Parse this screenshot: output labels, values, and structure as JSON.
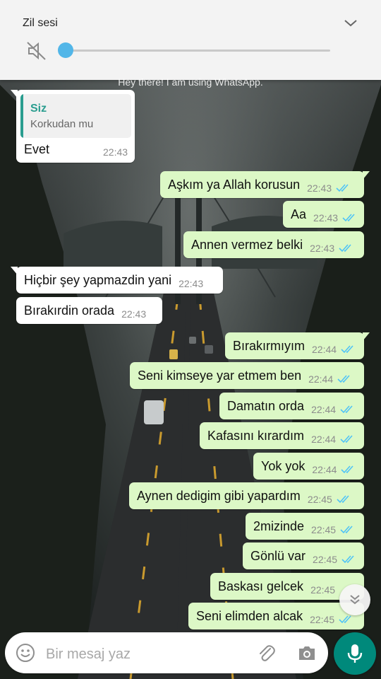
{
  "volume_panel": {
    "title": "Zil sesi",
    "level": 0
  },
  "chat": {
    "status_hint": "Hey there! I am using WhatsApp.",
    "reply": {
      "quote_author": "Siz",
      "quote_text": "Korkudan mu",
      "text": "Evet",
      "time": "22:43"
    },
    "messages": [
      {
        "dir": "out",
        "text": "Aşkım ya Allah korusun",
        "time": "22:43"
      },
      {
        "dir": "out",
        "text": "Aa",
        "time": "22:43"
      },
      {
        "dir": "out",
        "text": "Annen vermez belki",
        "time": "22:43"
      },
      {
        "dir": "in",
        "text": "Hiçbir şey yapmazdin yani",
        "time": "22:43"
      },
      {
        "dir": "in",
        "text": "Bırakırdin orada",
        "time": "22:43"
      },
      {
        "dir": "out",
        "text": "Bırakırmıyım",
        "time": "22:44"
      },
      {
        "dir": "out",
        "text": "Seni kimseye yar etmem ben",
        "time": "22:44"
      },
      {
        "dir": "out",
        "text": "Damatın orda",
        "time": "22:44"
      },
      {
        "dir": "out",
        "text": "Kafasını kırardım",
        "time": "22:44"
      },
      {
        "dir": "out",
        "text": "Yok yok",
        "time": "22:44"
      },
      {
        "dir": "out",
        "text": "Aynen dedigim gibi yapardım",
        "time": "22:45"
      },
      {
        "dir": "out",
        "text": "2mizinde",
        "time": "22:45"
      },
      {
        "dir": "out",
        "text": "Gönlü var",
        "time": "22:45"
      },
      {
        "dir": "out",
        "text": "Baskası gelcek",
        "time": "22:45"
      },
      {
        "dir": "out",
        "text": "Seni elimden alcak",
        "time": "22:45"
      }
    ]
  },
  "composer": {
    "placeholder": "Bir mesaj yaz"
  },
  "colors": {
    "outgoing": "#dcf8c6",
    "incoming": "#ffffff",
    "accent": "#00897b",
    "read_ticks": "#4fc3f7",
    "volume_knob": "#52b6e8"
  },
  "icons": [
    "mute-icon",
    "chevron-down-icon",
    "emoji-icon",
    "attach-icon",
    "camera-icon",
    "mic-icon",
    "double-chevron-down-icon",
    "read-ticks-icon"
  ]
}
